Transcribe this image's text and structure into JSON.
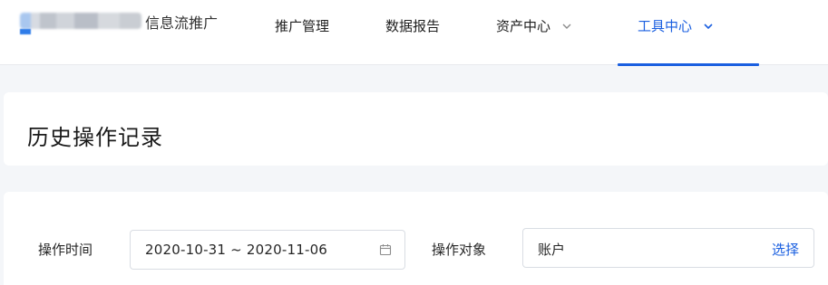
{
  "header": {
    "product_name": "信息流推广",
    "nav": [
      {
        "label": "推广管理",
        "has_dropdown": false,
        "active": false
      },
      {
        "label": "数据报告",
        "has_dropdown": false,
        "active": false
      },
      {
        "label": "资产中心",
        "has_dropdown": true,
        "active": false
      },
      {
        "label": "工具中心",
        "has_dropdown": true,
        "active": true
      }
    ]
  },
  "page": {
    "title": "历史操作记录"
  },
  "filters": {
    "time_label": "操作时间",
    "date_range": "2020-10-31 ~ 2020-11-06",
    "object_label": "操作对象",
    "object_value": "账户",
    "object_select": "选择"
  },
  "colors": {
    "accent": "#1a5fe0",
    "background": "#f4f6f9"
  },
  "icons": [
    "chevron-down-icon",
    "calendar-icon"
  ]
}
